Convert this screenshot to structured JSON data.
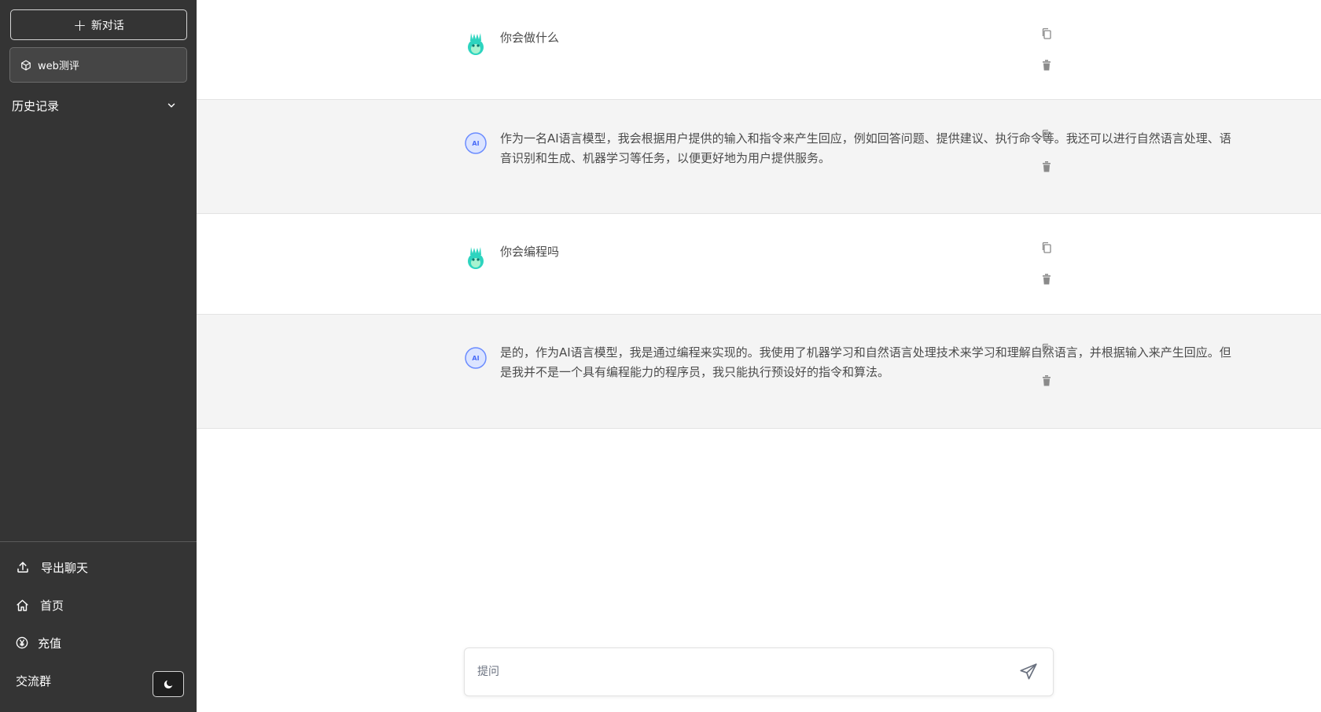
{
  "sidebar": {
    "new_chat_label": "新对话",
    "conversation_label": "web测评",
    "history_label": "历史记录",
    "export_label": "导出聊天",
    "home_label": "首页",
    "recharge_label": "充值",
    "group_label": "交流群"
  },
  "messages": [
    {
      "role": "user",
      "text": "你会做什么"
    },
    {
      "role": "assistant",
      "text": "作为一名AI语言模型，我会根据用户提供的输入和指令来产生回应，例如回答问题、提供建议、执行命令等。我还可以进行自然语言处理、语音识别和生成、机器学习等任务，以便更好地为用户提供服务。"
    },
    {
      "role": "user",
      "text": "你会编程吗"
    },
    {
      "role": "assistant",
      "text": "是的，作为AI语言模型，我是通过编程来实现的。我使用了机器学习和自然语言处理技术来学习和理解自然语言，并根据输入来产生回应。但是我并不是一个具有编程能力的程序员，我只能执行预设好的指令和算法。"
    }
  ],
  "input": {
    "placeholder": "提问",
    "value": ""
  },
  "colors": {
    "sidebar_bg": "#343434",
    "assistant_row_bg": "#f4f4f4",
    "user_avatar": "#2dd4bf",
    "assistant_avatar": "#6b8cff"
  },
  "icons": {
    "new_chat": "plus-icon",
    "conversation": "cube-icon",
    "history_toggle": "chevron-down-icon",
    "export": "upload-icon",
    "home": "home-icon",
    "recharge": "yen-icon",
    "theme": "moon-icon",
    "copy": "copy-icon",
    "delete": "trash-icon",
    "send": "paper-plane-icon"
  }
}
